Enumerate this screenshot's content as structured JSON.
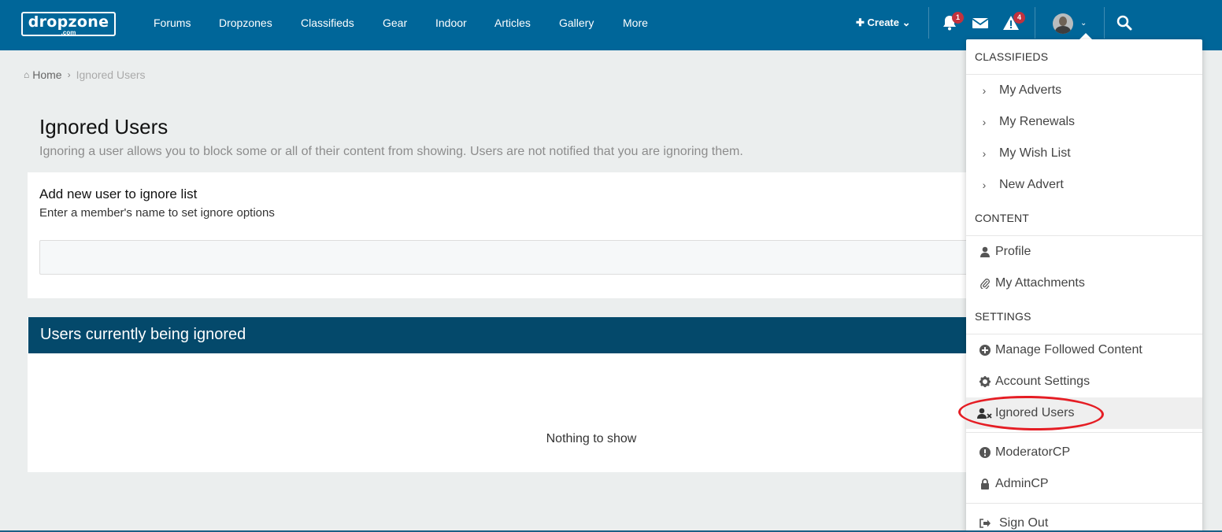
{
  "header": {
    "logo_main": "dropzone",
    "logo_sub": ".com",
    "nav": [
      "Forums",
      "Dropzones",
      "Classifieds",
      "Gear",
      "Indoor",
      "Articles",
      "Gallery",
      "More"
    ],
    "create_label": "Create",
    "notifications_count": "1",
    "reports_count": "4",
    "icons": [
      "bell-icon",
      "envelope-icon",
      "warning-icon",
      "avatar",
      "search-icon"
    ],
    "brand_color": "#006699"
  },
  "breadcrumb": {
    "home": "Home",
    "current": "Ignored Users"
  },
  "page": {
    "title": "Ignored Users",
    "description": "Ignoring a user allows you to block some or all of their content from showing. Users are not notified that you are ignoring them."
  },
  "add_box": {
    "title": "Add new user to ignore list",
    "subtitle": "Enter a member's name to set ignore options",
    "input_value": ""
  },
  "ignored_panel": {
    "title": "Users currently being ignored",
    "empty_text": "Nothing to show",
    "header_color": "#04496b"
  },
  "user_menu": {
    "sections": [
      {
        "label": "CLASSIFIEDS",
        "items": [
          {
            "label": "My Adverts",
            "icon": "chevron-right-icon"
          },
          {
            "label": "My Renewals",
            "icon": "chevron-right-icon"
          },
          {
            "label": "My Wish List",
            "icon": "chevron-right-icon"
          },
          {
            "label": "New Advert",
            "icon": "chevron-right-icon"
          }
        ]
      },
      {
        "label": "CONTENT",
        "items": [
          {
            "label": "Profile",
            "icon": "user-icon"
          },
          {
            "label": "My Attachments",
            "icon": "paperclip-icon"
          }
        ]
      },
      {
        "label": "SETTINGS",
        "items": [
          {
            "label": "Manage Followed Content",
            "icon": "plus-circle-icon"
          },
          {
            "label": "Account Settings",
            "icon": "gear-icon"
          },
          {
            "label": "Ignored Users",
            "icon": "user-times-icon",
            "active": true
          }
        ]
      }
    ],
    "admin_items": [
      {
        "label": "ModeratorCP",
        "icon": "exclamation-circle-icon"
      },
      {
        "label": "AdminCP",
        "icon": "lock-icon"
      }
    ],
    "sign_out": "Sign Out",
    "annotation_color": "#e51d24"
  }
}
